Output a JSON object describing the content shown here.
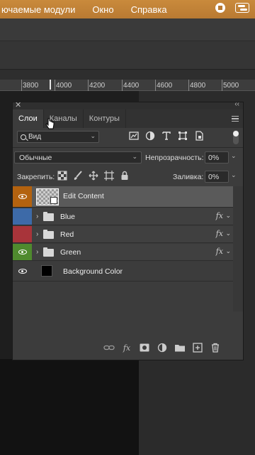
{
  "menubar": {
    "items": [
      "ючаемые модули",
      "Окно",
      "Справка"
    ],
    "icons": [
      "stop-icon",
      "control-center-icon"
    ]
  },
  "ruler": {
    "ticks": [
      "3800",
      "4000",
      "4200",
      "4400",
      "4600",
      "4800",
      "5000"
    ]
  },
  "panel": {
    "tabs": [
      "Слои",
      "Каналы",
      "Контуры"
    ],
    "active_tab": "Слои",
    "filter": {
      "value": "Вид"
    },
    "blend_mode": "Обычные",
    "opacity_label": "Непрозрачность:",
    "opacity_value": "0%",
    "lock_label": "Закрепить:",
    "fill_label": "Заливка:",
    "fill_value": "0%",
    "layers": [
      {
        "name": "Edit Content",
        "type": "smart-object",
        "visible": true,
        "color": "#b3620f"
      },
      {
        "name": "Blue",
        "type": "group",
        "visible": false,
        "color": "#3d6aa8",
        "fx": "fx"
      },
      {
        "name": "Red",
        "type": "group",
        "visible": false,
        "color": "#a8343a",
        "fx": "fx"
      },
      {
        "name": "Green",
        "type": "group",
        "visible": true,
        "color": "#4f8a2e",
        "fx": "fx"
      },
      {
        "name": "Background Color",
        "type": "fill",
        "visible": true,
        "color": "#3c3c3c"
      }
    ]
  },
  "colors": {
    "menubar": "#b97a32",
    "panel_bg": "#3c3c3c"
  }
}
